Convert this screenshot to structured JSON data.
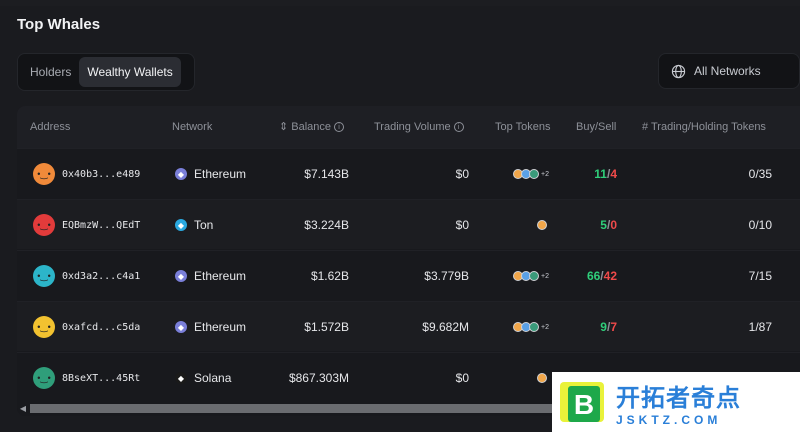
{
  "section_title": "Top Whales",
  "tabs": [
    {
      "label": "Holders",
      "active": false
    },
    {
      "label": "Wealthy Wallets",
      "active": true
    }
  ],
  "network_filter": {
    "label": "All Networks",
    "icon": "globe-icon"
  },
  "table": {
    "headers": {
      "address": "Address",
      "network": "Network",
      "balance": "Balance",
      "trading_volume": "Trading Volume",
      "top_tokens": "Top Tokens",
      "buy_sell": "Buy/Sell",
      "holding": "# Trading/Holding Tokens"
    },
    "rows": [
      {
        "address": "0x40b3...e489",
        "network": "Ethereum",
        "balance": "$7.143B",
        "volume": "$0",
        "tokens_extra": "+2",
        "buy": "11",
        "sell": "4",
        "holding": "0/35",
        "avatar_color": "#f08a3a",
        "net_color": "#7a7fd9"
      },
      {
        "address": "EQBmzW...QEdT",
        "network": "Ton",
        "balance": "$3.224B",
        "volume": "$0",
        "tokens_extra": "",
        "buy": "5",
        "sell": "0",
        "holding": "0/10",
        "avatar_color": "#e23b3b",
        "net_color": "#2aa9e0"
      },
      {
        "address": "0xd3a2...c4a1",
        "network": "Ethereum",
        "balance": "$1.62B",
        "volume": "$3.779B",
        "tokens_extra": "+2",
        "buy": "66",
        "sell": "42",
        "holding": "7/15",
        "avatar_color": "#2cb5c9",
        "net_color": "#7a7fd9"
      },
      {
        "address": "0xafcd...c5da",
        "network": "Ethereum",
        "balance": "$1.572B",
        "volume": "$9.682M",
        "tokens_extra": "+2",
        "buy": "9",
        "sell": "7",
        "holding": "1/87",
        "avatar_color": "#f2c230",
        "net_color": "#7a7fd9"
      },
      {
        "address": "8BseXT...45Rt",
        "network": "Solana",
        "balance": "$867.303M",
        "volume": "$0",
        "tokens_extra": "",
        "buy": "",
        "sell": "",
        "holding": "",
        "avatar_color": "#2f9e7a",
        "net_color": "#1a1a1a"
      }
    ]
  },
  "watermark": {
    "cn": "开拓者奇点",
    "en": "JSKTZ.COM"
  }
}
